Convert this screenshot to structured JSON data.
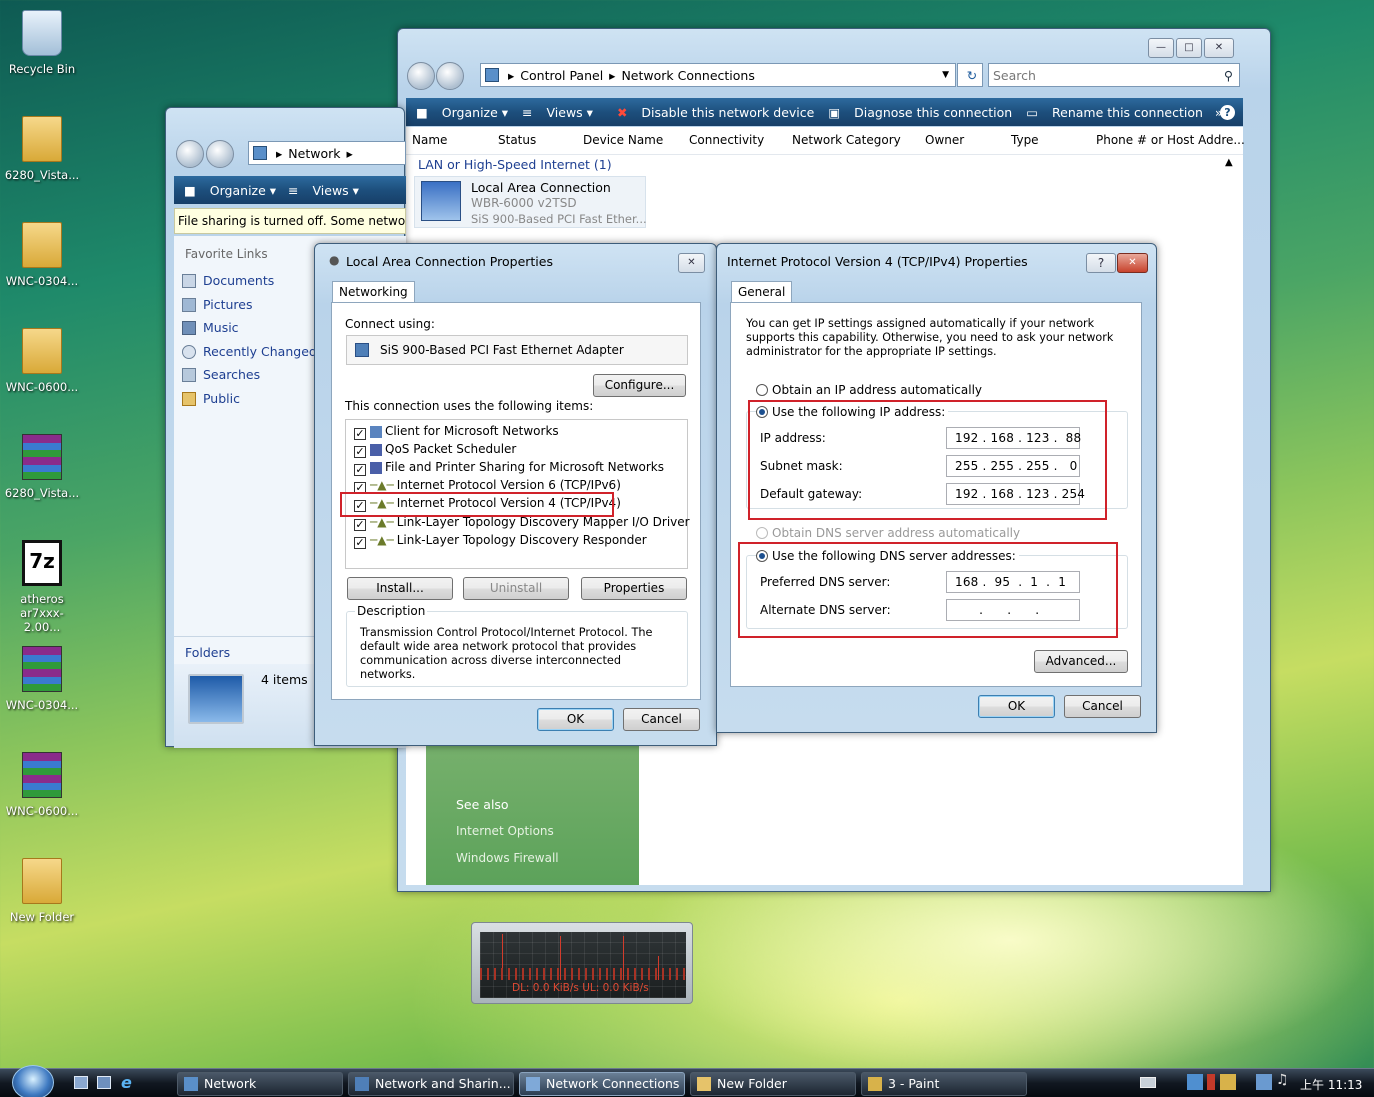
{
  "desktop": {
    "icons": [
      {
        "label": "Recycle Bin"
      },
      {
        "label": "6280_Vista..."
      },
      {
        "label": "WNC-0304..."
      },
      {
        "label": "WNC-0600..."
      },
      {
        "label": "6280_Vista..."
      },
      {
        "label": "atheros ar7xxx-2.00..."
      },
      {
        "label": "WNC-0304..."
      },
      {
        "label": "WNC-0600..."
      },
      {
        "label": "New Folder"
      }
    ]
  },
  "network_window": {
    "breadcrumb": [
      "Network"
    ],
    "toolbar": {
      "organize": "Organize",
      "views": "Views"
    },
    "infobar": "File sharing is turned off. Some network",
    "favorite_links_title": "Favorite Links",
    "links": [
      "Documents",
      "Pictures",
      "Music",
      "Recently Changed",
      "Searches",
      "Public"
    ],
    "folders": "Folders",
    "items_count": "4 items"
  },
  "netconn_window": {
    "breadcrumb": [
      "Control Panel",
      "Network Connections"
    ],
    "search_placeholder": "Search",
    "toolbar": {
      "organize": "Organize",
      "views": "Views",
      "disable": "Disable this network device",
      "diagnose": "Diagnose this connection",
      "rename": "Rename this connection",
      "more": "»"
    },
    "columns": [
      "Name",
      "Status",
      "Device Name",
      "Connectivity",
      "Network Category",
      "Owner",
      "Type",
      "Phone # or Host Addre..."
    ],
    "group_header": "LAN or High-Speed Internet (1)",
    "connection": {
      "name": "Local Area Connection",
      "status": "WBR-6000 v2TSD",
      "device": "SiS 900-Based PCI Fast Ether..."
    },
    "see_also": {
      "title": "See also",
      "links": [
        "Internet Options",
        "Windows Firewall"
      ]
    }
  },
  "lac_dialog": {
    "title": "Local Area Connection Properties",
    "tab": "Networking",
    "connect_using_label": "Connect using:",
    "adapter": "SiS 900-Based PCI Fast Ethernet Adapter",
    "configure": "Configure...",
    "items_label": "This connection uses the following items:",
    "items": [
      {
        "label": "Client for Microsoft Networks",
        "checked": true
      },
      {
        "label": "QoS Packet Scheduler",
        "checked": true
      },
      {
        "label": "File and Printer Sharing for Microsoft Networks",
        "checked": true
      },
      {
        "label": "Internet Protocol Version 6 (TCP/IPv6)",
        "checked": true
      },
      {
        "label": "Internet Protocol Version 4 (TCP/IPv4)",
        "checked": true
      },
      {
        "label": "Link-Layer Topology Discovery Mapper I/O Driver",
        "checked": true
      },
      {
        "label": "Link-Layer Topology Discovery Responder",
        "checked": true
      }
    ],
    "install": "Install...",
    "uninstall": "Uninstall",
    "properties": "Properties",
    "description_label": "Description",
    "description": "Transmission Control Protocol/Internet Protocol. The default wide area network protocol that provides communication across diverse interconnected networks.",
    "ok": "OK",
    "cancel": "Cancel"
  },
  "ipv4_dialog": {
    "title": "Internet Protocol Version 4 (TCP/IPv4) Properties",
    "tab": "General",
    "intro": "You can get IP settings assigned automatically if your network supports this capability. Otherwise, you need to ask your network administrator for the appropriate IP settings.",
    "obtain_ip_auto": "Obtain an IP address automatically",
    "use_following_ip": "Use the following IP address:",
    "ip_label": "IP address:",
    "ip_value": "192 . 168 . 123 .  88",
    "subnet_label": "Subnet mask:",
    "subnet_value": "255 . 255 . 255 .   0",
    "gateway_label": "Default gateway:",
    "gateway_value": "192 . 168 . 123 . 254",
    "obtain_dns_auto": "Obtain DNS server address automatically",
    "use_following_dns": "Use the following DNS server addresses:",
    "preferred_dns_label": "Preferred DNS server:",
    "preferred_dns_value": "168 .  95  .  1  .  1",
    "alternate_dns_label": "Alternate DNS server:",
    "alternate_dns_value": "      .      .      .",
    "advanced": "Advanced...",
    "ok": "OK",
    "cancel": "Cancel",
    "help": "?"
  },
  "meter": {
    "text": "DL: 0.0 KiB/s  UL: 0.0 KiB/s"
  },
  "taskbar": {
    "buttons": [
      "Network",
      "Network and Sharin...",
      "Network Connections",
      "New Folder",
      "3 - Paint"
    ],
    "clock": "上午 11:13"
  }
}
